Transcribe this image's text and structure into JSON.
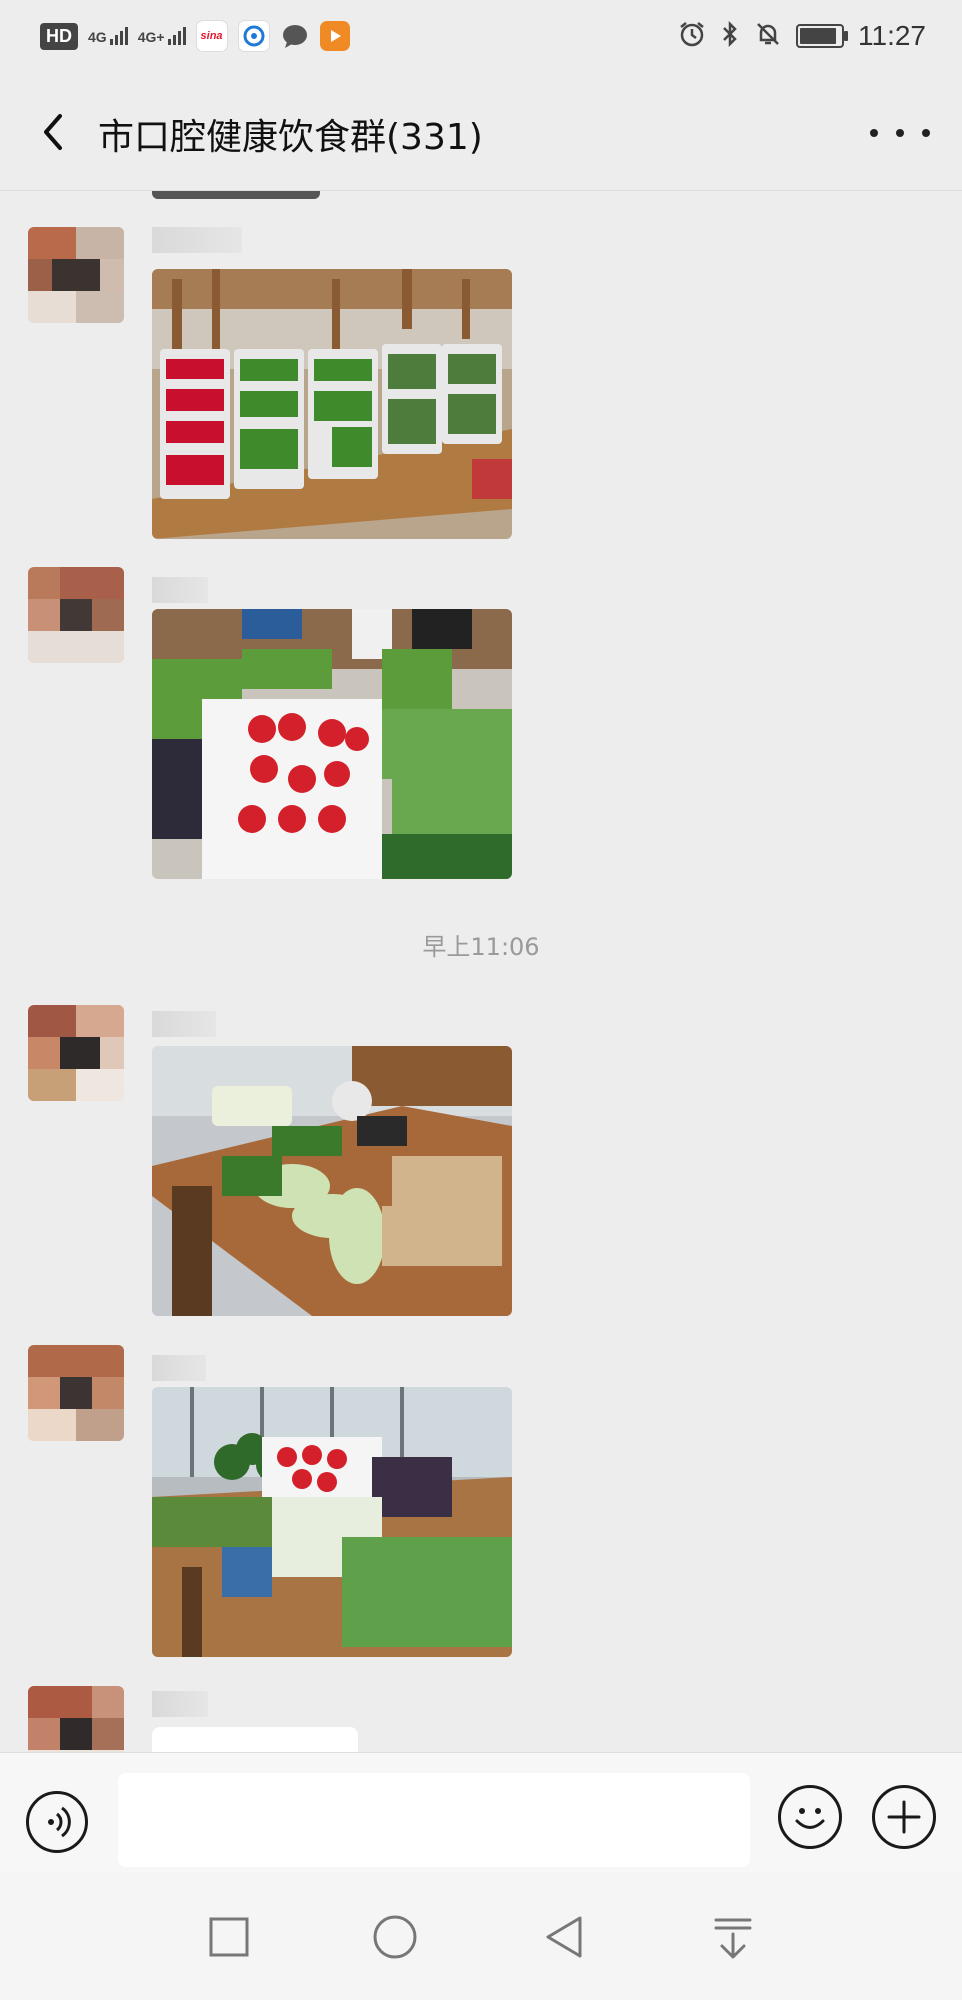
{
  "status_bar": {
    "left_indicators": [
      "HD",
      "4G",
      "4G+"
    ],
    "apps": [
      {
        "name": "sina-icon",
        "label": "sina",
        "color": "#e6162d"
      },
      {
        "name": "browser-icon",
        "label": "",
        "color": "#1f7ad6"
      },
      {
        "name": "chat-bubble-icon",
        "label": "",
        "color": "#555555"
      },
      {
        "name": "video-play-icon",
        "label": "",
        "color": "#f08a24"
      }
    ],
    "right_icons": [
      "alarm-icon",
      "bluetooth-icon",
      "mute-bell-icon",
      "battery-icon"
    ],
    "time": "11:27"
  },
  "header": {
    "title": "市口腔健康饮食群(331)",
    "back_icon": "chevron-left-icon",
    "more_icon": "more-dots-icon"
  },
  "chat": {
    "timestamp": "早上11:06",
    "messages": [
      {
        "type": "image",
        "subject": "vegetables-on-table-peppers"
      },
      {
        "type": "image",
        "subject": "vegetables-tomatoes-greens"
      },
      {
        "type": "image",
        "subject": "vegetables-cabbage-table"
      },
      {
        "type": "image",
        "subject": "vegetables-by-window"
      },
      {
        "type": "text",
        "subject": "partial-message"
      }
    ]
  },
  "input_bar": {
    "voice_icon": "voice-icon",
    "emoji_icon": "emoji-icon",
    "plus_icon": "plus-icon",
    "text_value": ""
  },
  "nav_bar": {
    "buttons": [
      "recent-apps-icon",
      "home-icon",
      "back-triangle-icon",
      "notification-pulldown-icon"
    ]
  },
  "colors": {
    "background": "#ededed",
    "bubble": "#ffffff",
    "timestamp_text": "#9a9a9a"
  }
}
